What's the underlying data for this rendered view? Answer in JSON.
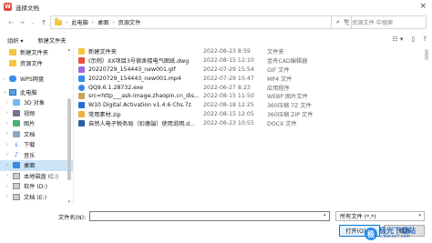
{
  "window": {
    "title": "选择文档",
    "app_icon_glyph": "W"
  },
  "address": {
    "crumbs": [
      "此电脑",
      "桌面",
      "资源文件"
    ],
    "separator": "›",
    "search_placeholder": "在 资源文件 中搜索"
  },
  "toolbar": {
    "organize": "组织 ▾",
    "new_folder": "新建文件夹"
  },
  "sidebar": {
    "items": [
      {
        "label": "新建文件夹",
        "icon": "folder-icon"
      },
      {
        "label": "资源文件",
        "icon": "folder-icon"
      },
      {
        "label": "WPS网盘",
        "icon": "cloud-icon"
      },
      {
        "label": "此电脑",
        "icon": "computer-icon"
      },
      {
        "label": "3D 对象",
        "icon": "3d-objects-icon"
      },
      {
        "label": "视频",
        "icon": "video-icon"
      },
      {
        "label": "图片",
        "icon": "pictures-icon"
      },
      {
        "label": "文档",
        "icon": "documents-icon"
      },
      {
        "label": "下载",
        "icon": "download-icon"
      },
      {
        "label": "音乐",
        "icon": "music-icon"
      },
      {
        "label": "桌面",
        "icon": "desktop-icon"
      },
      {
        "label": "本地磁盘 (C:)",
        "icon": "drive-icon"
      },
      {
        "label": "软件 (D:)",
        "icon": "drive-icon"
      },
      {
        "label": "文档 (E:)",
        "icon": "drive-icon"
      }
    ]
  },
  "files": [
    {
      "name": "新建文件夹",
      "date": "2022-08-23 8:59",
      "type": "文件夹",
      "size": "",
      "icon": "folder-icon"
    },
    {
      "name": "(示例）XX项目3号宿舍楼电气图纸.dwg",
      "date": "2022-08-15 12:10",
      "type": "金舟CAD编辑器",
      "size": "",
      "icon": "dwg-file-icon"
    },
    {
      "name": "20220729_154443_new001.gif",
      "date": "2022-07-29 15:54",
      "type": "GIF 文件",
      "size": "",
      "icon": "gif-file-icon"
    },
    {
      "name": "20220729_154443_new001.mp4",
      "date": "2022-07-29 15:47",
      "type": "MP4 文件",
      "size": "",
      "icon": "mp4-file-icon"
    },
    {
      "name": "QQ9.6.1.28732.exe",
      "date": "2022-06-27 8:23",
      "type": "应用程序",
      "size": "",
      "icon": "exe-file-icon"
    },
    {
      "name": "src=http___ask-image.zhaopin.cn_dis...",
      "date": "2022-08-15 11:50",
      "type": "WEBP 图片文件",
      "size": "",
      "icon": "webp-file-icon"
    },
    {
      "name": "W10 Digital Activation v1.4.6 Chs.7z",
      "date": "2022-08-18 12:25",
      "type": "360压缩 7Z 文件",
      "size": "",
      "icon": "7z-file-icon"
    },
    {
      "name": "常用素材.zip",
      "date": "2022-08-15 12:05",
      "type": "360压缩 ZIP 文件",
      "size": "",
      "icon": "zip-file-icon"
    },
    {
      "name": "自然人电子税务局（扣缴端）使用说明.d...",
      "date": "2022-08-23 10:55",
      "type": "DOCX 文件",
      "size": "",
      "icon": "docx-file-icon"
    }
  ],
  "bottom": {
    "filename_label": "文件名(N):",
    "filename_value": "",
    "filetype_value": "所有文件 (*.*)",
    "open_label": "打开(O)",
    "cancel_label": "取消"
  },
  "watermark": {
    "logo_glyph": "极",
    "name": "极光下载站",
    "url": "www.xz7.com"
  },
  "colors": {
    "accent": "#0078d7",
    "selection": "#cce4f7",
    "folder": "#f5c542"
  }
}
